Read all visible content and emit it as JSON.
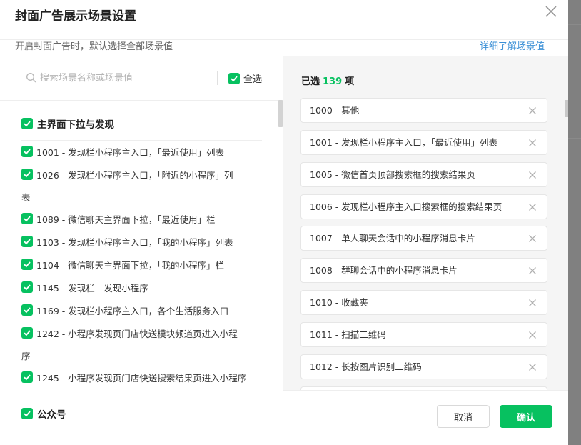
{
  "dialog": {
    "title": "封面广告展示场景设置",
    "subtitle": "开启封面广告时，默认选择全部场景值",
    "learn_more": "详细了解场景值"
  },
  "search": {
    "placeholder": "搜索场景名称或场景值"
  },
  "select_all_label": "全选",
  "groups": [
    {
      "label": "主界面下拉与发现",
      "items": [
        {
          "line1": "1001 - 发现栏小程序主入口，「最近使用」列表",
          "line2": ""
        },
        {
          "line1": "1026 - 发现栏小程序主入口，「附近的小程序」列",
          "line2": "表"
        },
        {
          "line1": "1089 - 微信聊天主界面下拉，「最近使用」栏",
          "line2": ""
        },
        {
          "line1": "1103 - 发现栏小程序主入口，「我的小程序」列表",
          "line2": ""
        },
        {
          "line1": "1104 - 微信聊天主界面下拉，「我的小程序」栏",
          "line2": ""
        },
        {
          "line1": "1145 - 发现栏 - 发现小程序",
          "line2": ""
        },
        {
          "line1": "1169 - 发现栏小程序主入口，各个生活服务入口",
          "line2": ""
        },
        {
          "line1": "1242 - 小程序发现页门店快送模块频道页进入小程",
          "line2": "序"
        },
        {
          "line1": "1245 - 小程序发现页门店快送搜索结果页进入小程序",
          "line2": ""
        }
      ]
    },
    {
      "label": "公众号",
      "items": []
    }
  ],
  "selected": {
    "prefix": "已选",
    "count": "139",
    "suffix": "项",
    "items": [
      "1000 - 其他",
      "1001 - 发现栏小程序主入口，「最近使用」列表",
      "1005 - 微信首页顶部搜索框的搜索结果页",
      "1006 - 发现栏小程序主入口搜索框的搜索结果页",
      "1007 - 单人聊天会话中的小程序消息卡片",
      "1008 - 群聊会话中的小程序消息卡片",
      "1010 - 收藏夹",
      "1011 - 扫描二维码",
      "1012 - 长按图片识别二维码",
      ""
    ]
  },
  "buttons": {
    "cancel": "取消",
    "ok": "确认"
  },
  "colors": {
    "accent": "#07c160",
    "link": "#3a8fd6"
  }
}
